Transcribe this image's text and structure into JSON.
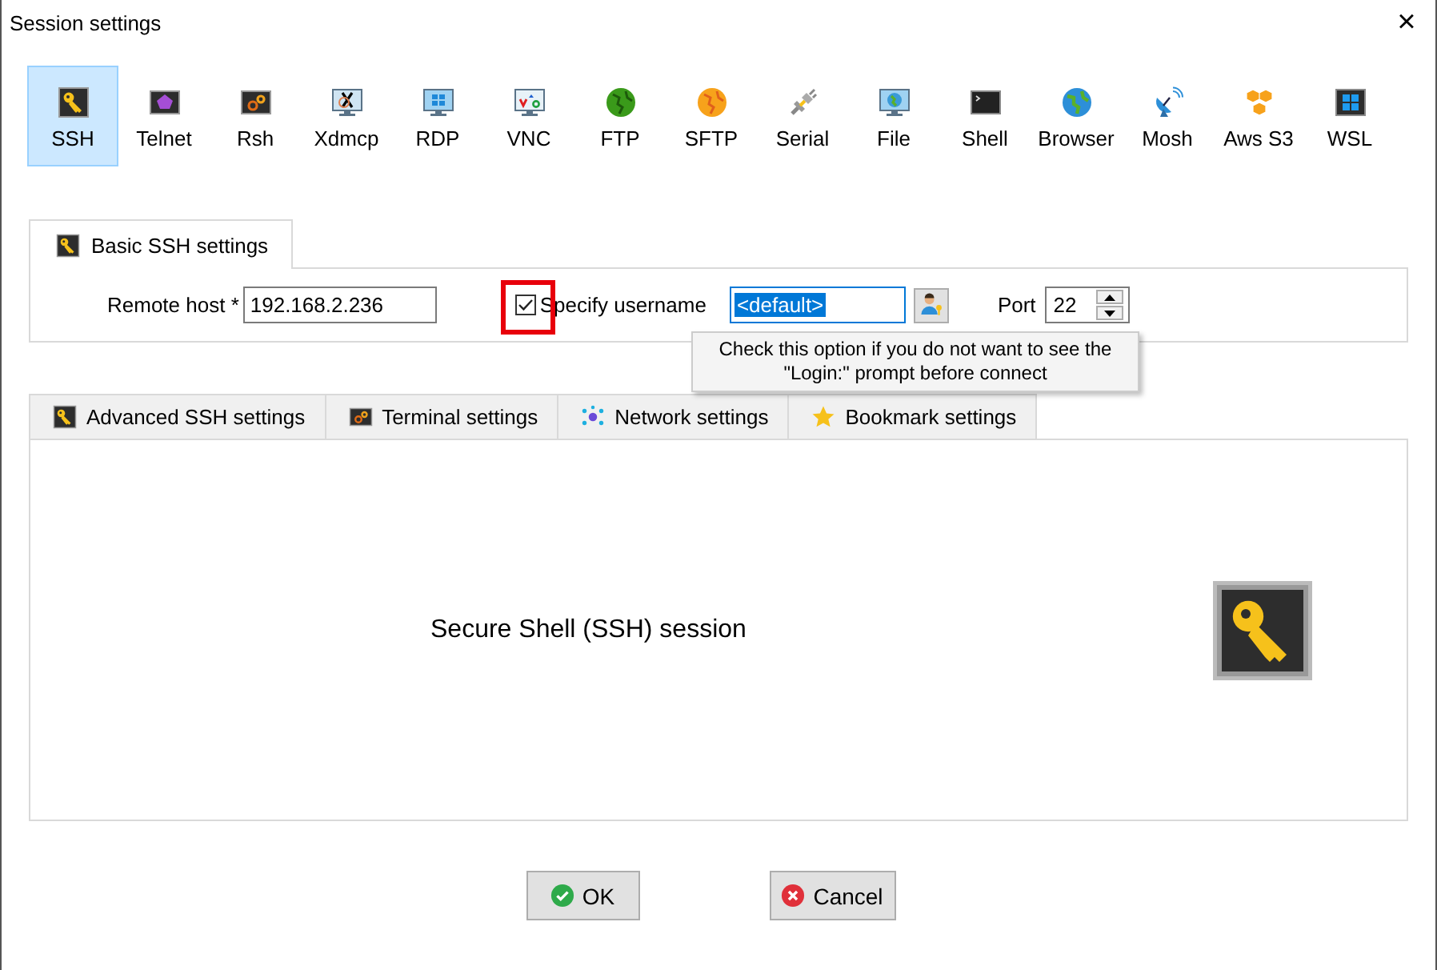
{
  "window": {
    "title": "Session settings",
    "close": "×"
  },
  "protocols": [
    {
      "label": "SSH",
      "selected": true
    },
    {
      "label": "Telnet",
      "selected": false
    },
    {
      "label": "Rsh",
      "selected": false
    },
    {
      "label": "Xdmcp",
      "selected": false
    },
    {
      "label": "RDP",
      "selected": false
    },
    {
      "label": "VNC",
      "selected": false
    },
    {
      "label": "FTP",
      "selected": false
    },
    {
      "label": "SFTP",
      "selected": false
    },
    {
      "label": "Serial",
      "selected": false
    },
    {
      "label": "File",
      "selected": false
    },
    {
      "label": "Shell",
      "selected": false
    },
    {
      "label": "Browser",
      "selected": false
    },
    {
      "label": "Mosh",
      "selected": false
    },
    {
      "label": "Aws S3",
      "selected": false
    },
    {
      "label": "WSL",
      "selected": false
    }
  ],
  "basic_tab": {
    "label": "Basic SSH settings"
  },
  "basic": {
    "remote_host_label": "Remote host *",
    "remote_host": "192.168.2.236",
    "specify_username": {
      "label": "Specify username",
      "checked": true,
      "highlighted": true
    },
    "username": "<default>",
    "port_label": "Port",
    "port": "22"
  },
  "tooltip": "Check this option if you do not want to see the \"Login:\" prompt before connect",
  "tabs": [
    {
      "label": "Advanced SSH settings",
      "selected": false
    },
    {
      "label": "Terminal settings",
      "selected": false
    },
    {
      "label": "Network settings",
      "selected": false
    },
    {
      "label": "Bookmark settings",
      "selected": false
    }
  ],
  "panel": {
    "description": "Secure Shell (SSH) session"
  },
  "buttons": [
    {
      "label": "OK",
      "kind": "ok"
    },
    {
      "label": "Cancel",
      "kind": "cancel"
    }
  ]
}
